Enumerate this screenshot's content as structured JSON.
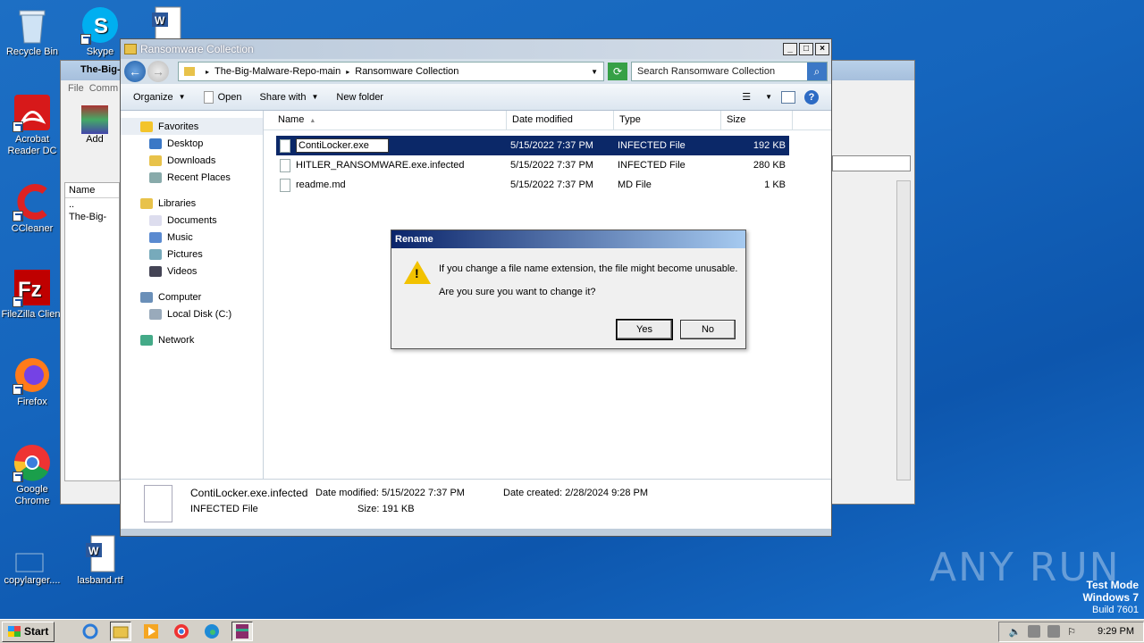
{
  "desktop": {
    "icons": [
      {
        "label": "Recycle Bin"
      },
      {
        "label": "Skype"
      },
      {
        "label": "Acrobat Reader DC"
      },
      {
        "label": "CCleaner"
      },
      {
        "label": "FileZilla Client"
      },
      {
        "label": "Firefox"
      },
      {
        "label": "Google Chrome"
      },
      {
        "label": "copylarger...."
      },
      {
        "label": "lasband.rtf"
      }
    ],
    "watermark": "ANY RUN",
    "test_mode": {
      "line1": "Test Mode",
      "line2": "Windows 7",
      "line3": "Build 7601"
    }
  },
  "bg_window": {
    "title": "The-Big-",
    "menu_file": "File",
    "menu_comm": "Comm",
    "add_label": "Add",
    "name_header": "Name",
    "up_item": "..",
    "folder_item": "The-Big-"
  },
  "explorer": {
    "title": "Ransomware Collection",
    "breadcrumb": [
      "The-Big-Malware-Repo-main",
      "Ransomware Collection"
    ],
    "search_placeholder": "Search Ransomware Collection",
    "toolbar": {
      "organize": "Organize",
      "open": "Open",
      "share_with": "Share with",
      "new_folder": "New folder"
    },
    "nav": {
      "favorites": "Favorites",
      "desktop": "Desktop",
      "downloads": "Downloads",
      "recent_places": "Recent Places",
      "libraries": "Libraries",
      "documents": "Documents",
      "music": "Music",
      "pictures": "Pictures",
      "videos": "Videos",
      "computer": "Computer",
      "local_disk": "Local Disk (C:)",
      "network": "Network"
    },
    "columns": {
      "name": "Name",
      "date": "Date modified",
      "type": "Type",
      "size": "Size"
    },
    "files": [
      {
        "name": "ContiLocker.exe",
        "date": "5/15/2022 7:37 PM",
        "type": "INFECTED File",
        "size": "192 KB"
      },
      {
        "name": "HITLER_RANSOMWARE.exe.infected",
        "date": "5/15/2022 7:37 PM",
        "type": "INFECTED File",
        "size": "280 KB"
      },
      {
        "name": "readme.md",
        "date": "5/15/2022 7:37 PM",
        "type": "MD File",
        "size": "1 KB"
      }
    ],
    "details": {
      "filename": "ContiLocker.exe.infected",
      "filetype": "INFECTED File",
      "date_modified": "Date modified: 5/15/2022 7:37 PM",
      "size": "Size: 191 KB",
      "date_created": "Date created: 2/28/2024 9:28 PM"
    }
  },
  "dialog": {
    "title": "Rename",
    "message1": "If you change a file name extension, the file might become unusable.",
    "message2": "Are you sure you want to change it?",
    "yes": "Yes",
    "no": "No"
  },
  "taskbar": {
    "start": "Start",
    "clock": "9:29 PM"
  }
}
